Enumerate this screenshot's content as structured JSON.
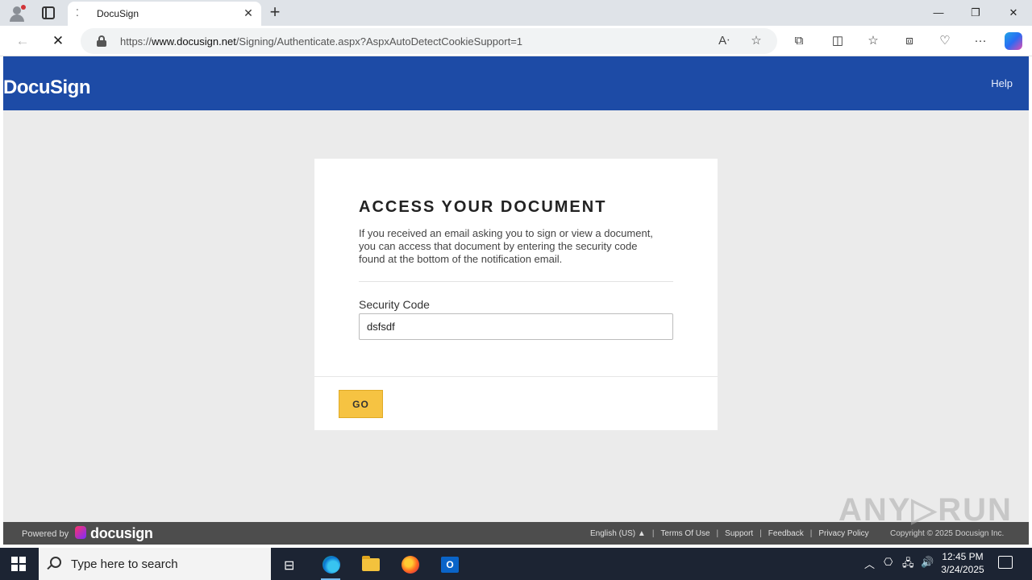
{
  "browser": {
    "tab_title": "DocuSign",
    "tab_close": "✕",
    "new_tab": "+",
    "url_prefix": "https://",
    "url_domain": "www.docusign.net",
    "url_path": "/Signing/Authenticate.aspx?AspxAutoDetectCookieSupport=1",
    "window_controls": {
      "minimize": "—",
      "restore": "❐",
      "close": "✕"
    }
  },
  "docusign": {
    "logo_text": "DocuSign",
    "help_link": "Help",
    "card": {
      "heading": "ACCESS YOUR DOCUMENT",
      "intro": "If you received an email asking you to sign or view a document, you can access that document by entering the security code found at the bottom of the notification email.",
      "field_label": "Security Code",
      "field_value": "dsfsdf",
      "go_button": "GO"
    },
    "footer": {
      "powered_by": "Powered by",
      "brand": "docusign",
      "links": [
        "English (US) ▲",
        "Terms Of Use",
        "Support",
        "Feedback",
        "Privacy Policy"
      ],
      "copyright": "Copyright © 2025 Docusign Inc."
    }
  },
  "watermark": "ANY▷RUN",
  "taskbar": {
    "search_placeholder": "Type here to search",
    "time": "12:45 PM",
    "date": "3/24/2025"
  }
}
